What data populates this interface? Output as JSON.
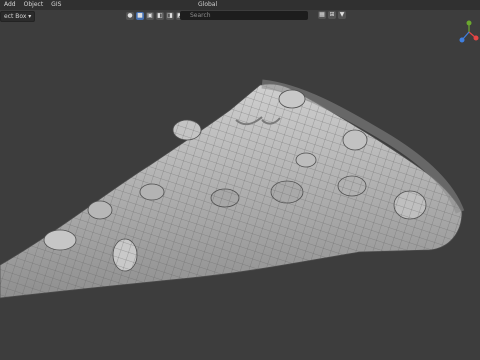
{
  "header": {
    "menu": [
      "Add",
      "Object",
      "GIS"
    ],
    "select_box": "ect Box ▾"
  },
  "toolbar": {
    "orientation": "Global",
    "search_placeholder": "Search"
  },
  "colors": {
    "bg": "#3d3d3d",
    "header": "#303030",
    "accent": "#4772b3",
    "mesh_fill": "#b4b4b4",
    "wire": "#4a4a4a",
    "axis_x": "#e54545",
    "axis_y": "#6ba82e",
    "axis_z": "#3f7fe0"
  },
  "icons": [
    "snap-icon",
    "pivot-icon",
    "proportional-icon",
    "view-icon",
    "grid-icon",
    "filter-icon"
  ]
}
